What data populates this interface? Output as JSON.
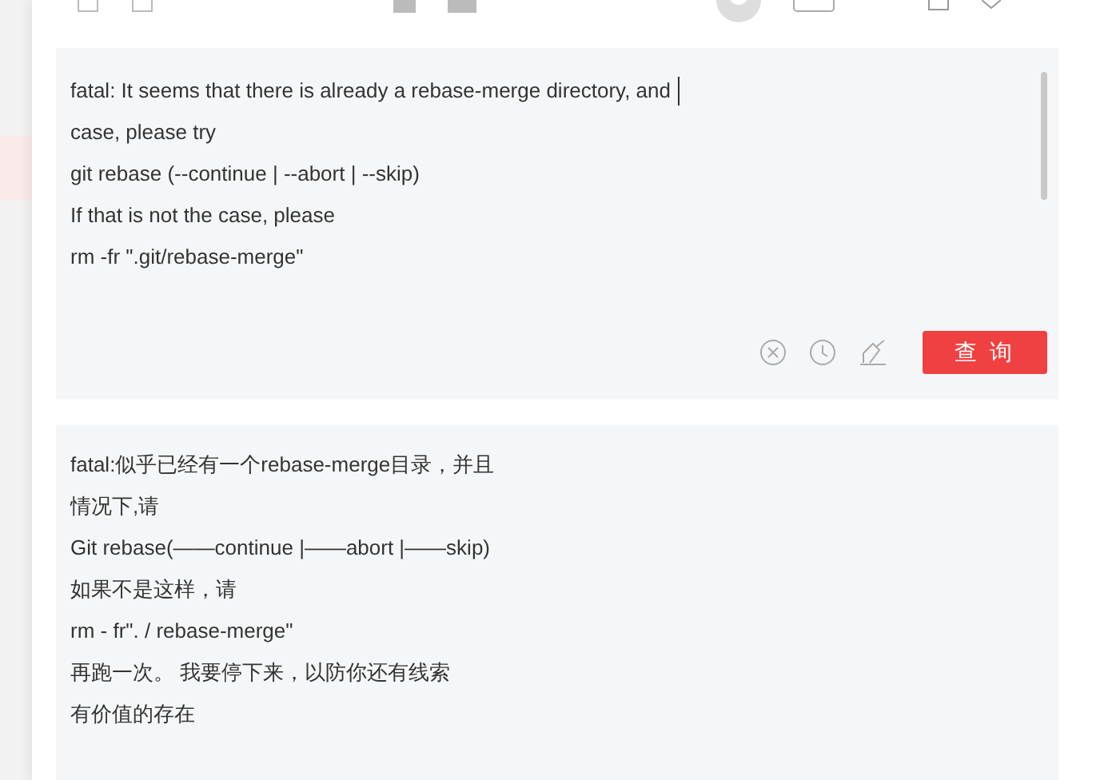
{
  "source": {
    "lines": [
      "fatal: It seems that there is already a rebase-merge directory, and",
      "case, please try",
      "git rebase (--continue | --abort | --skip)",
      "If that is not the case, please",
      "rm -fr \".git/rebase-merge\""
    ]
  },
  "query_button": {
    "label": "查 询"
  },
  "result": {
    "lines": [
      "fatal:似乎已经有一个rebase-merge目录，并且",
      "情况下,请",
      "Git rebase(——continue |——abort |——skip)",
      "如果不是这样，请",
      "rm - fr\". / rebase-merge\"",
      "再跑一次。 我要停下来，以防你还有线索",
      "有价值的存在"
    ]
  }
}
